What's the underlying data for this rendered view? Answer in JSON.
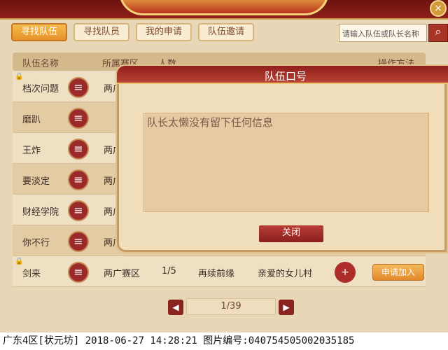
{
  "tabs": [
    "寻找队伍",
    "寻找队员",
    "我的申请",
    "队伍邀请"
  ],
  "search": {
    "placeholder": "请输入队伍或队长名称",
    "icon": "search-icon"
  },
  "header": {
    "col1": "队伍名称",
    "col2": "所属赛区",
    "col3": "人数",
    "col4": "操作方法"
  },
  "rows": [
    {
      "name": "档次问题",
      "zone": "两广",
      "count": "",
      "leader": "",
      "server": "",
      "locked": true
    },
    {
      "name": "磨趴",
      "zone": "",
      "count": "",
      "leader": "",
      "server": "",
      "locked": false
    },
    {
      "name": "王炸",
      "zone": "两广",
      "count": "",
      "leader": "",
      "server": "",
      "locked": false
    },
    {
      "name": "要淡定",
      "zone": "两广",
      "count": "",
      "leader": "",
      "server": "",
      "locked": false
    },
    {
      "name": "财经学院",
      "zone": "两广",
      "count": "",
      "leader": "",
      "server": "",
      "locked": false
    },
    {
      "name": "你不行",
      "zone": "两广",
      "count": "",
      "leader": "",
      "server": "",
      "locked": false
    },
    {
      "name": "剑来",
      "zone": "两广赛区",
      "count": "1/5",
      "leader": "再续前缘",
      "server": "亲爱的女儿村",
      "locked": true
    }
  ],
  "modal": {
    "title": "队伍口号",
    "message": "队长太懒没有留下任何信息",
    "close": "关闭"
  },
  "apply_label": "申请加入",
  "pager": {
    "text": "1/39"
  },
  "footer": "广东4区[状元坊] 2018-06-27 14:28:21 图片编号:040754505002035185"
}
